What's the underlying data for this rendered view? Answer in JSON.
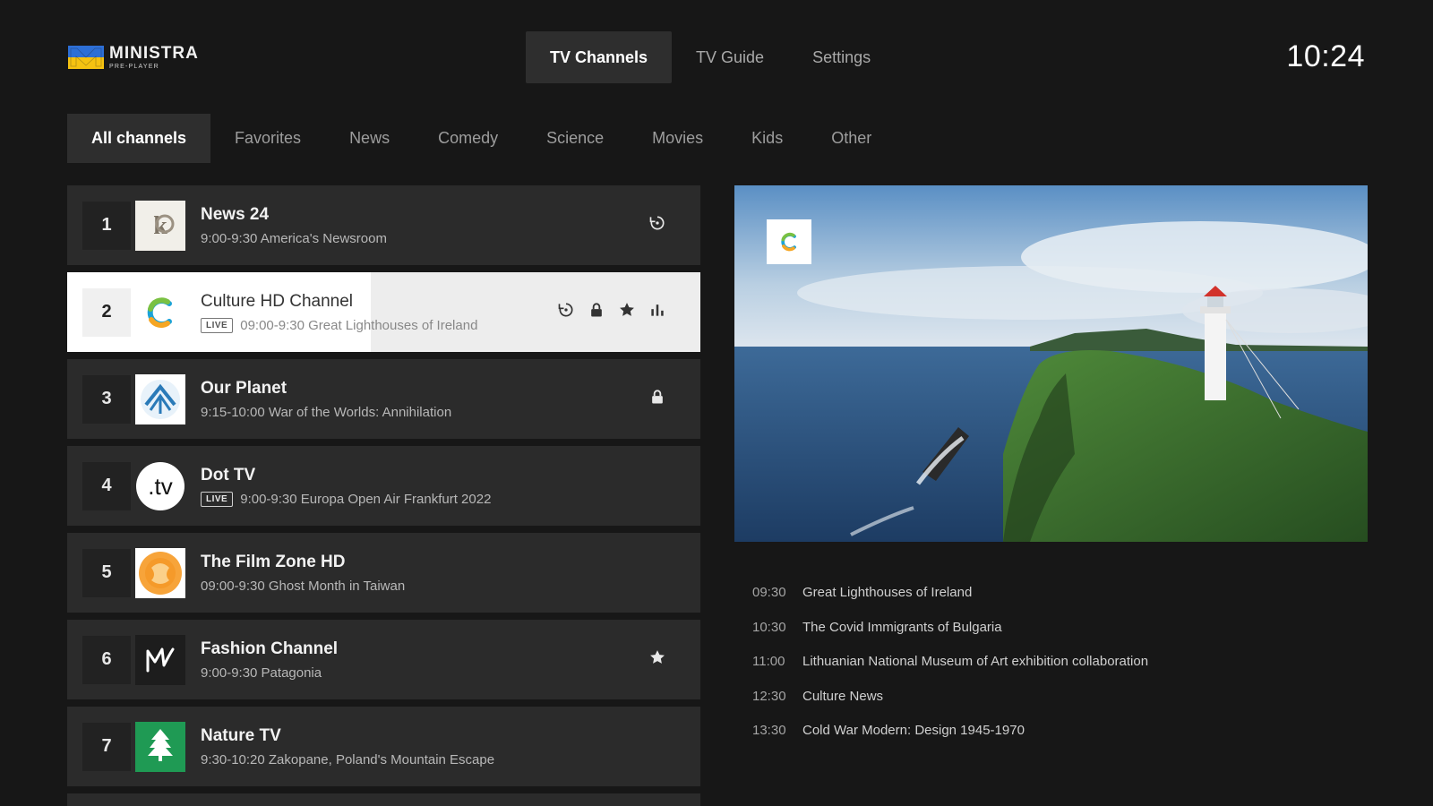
{
  "brand": {
    "title": "MINISTRA",
    "subtitle": "PRE-PLAYER"
  },
  "top_nav": [
    {
      "label": "TV Channels",
      "active": true
    },
    {
      "label": "TV Guide",
      "active": false
    },
    {
      "label": "Settings",
      "active": false
    }
  ],
  "clock": "10:24",
  "categories": [
    {
      "label": "All channels",
      "active": true
    },
    {
      "label": "Favorites",
      "active": false
    },
    {
      "label": "News",
      "active": false
    },
    {
      "label": "Comedy",
      "active": false
    },
    {
      "label": "Science",
      "active": false
    },
    {
      "label": "Movies",
      "active": false
    },
    {
      "label": "Kids",
      "active": false
    },
    {
      "label": "Other",
      "active": false
    }
  ],
  "channels": [
    {
      "number": "1",
      "name": "News 24",
      "program": "9:00-9:30 America's Newsroom",
      "live": false,
      "icons": [
        "replay-icon"
      ]
    },
    {
      "number": "2",
      "name": "Culture HD Channel",
      "program": "09:00-9:30 Great Lighthouses of Ireland",
      "live": true,
      "live_label": "LIVE",
      "selected": true,
      "progress": 0.48,
      "icons": [
        "replay-icon",
        "lock-icon",
        "star-icon",
        "equalizer-icon"
      ]
    },
    {
      "number": "3",
      "name": "Our Planet",
      "program": "9:15-10:00 War of the Worlds: Annihilation",
      "live": false,
      "icons": [
        "lock-icon"
      ]
    },
    {
      "number": "4",
      "name": "Dot TV",
      "program": "9:00-9:30 Europa Open Air Frankfurt 2022",
      "live": true,
      "live_label": "LIVE",
      "icons": []
    },
    {
      "number": "5",
      "name": "The Film Zone HD",
      "program": "09:00-9:30 Ghost Month in Taiwan",
      "live": false,
      "icons": []
    },
    {
      "number": "6",
      "name": "Fashion Channel",
      "program": "9:00-9:30 Patagonia",
      "live": false,
      "icons": [
        "star-icon"
      ]
    },
    {
      "number": "7",
      "name": "Nature TV",
      "program": "9:30-10:20 Zakopane, Poland's Mountain Escape",
      "live": false,
      "icons": []
    }
  ],
  "schedule": [
    {
      "time": "09:30",
      "title": "Great Lighthouses of Ireland"
    },
    {
      "time": "10:30",
      "title": "The Covid Immigrants of Bulgaria"
    },
    {
      "time": "11:00",
      "title": "Lithuanian National Museum of Art exhibition collaboration"
    },
    {
      "time": "12:30",
      "title": "Culture News"
    },
    {
      "time": "13:30",
      "title": "Cold War Modern: Design 1945-1970"
    }
  ]
}
